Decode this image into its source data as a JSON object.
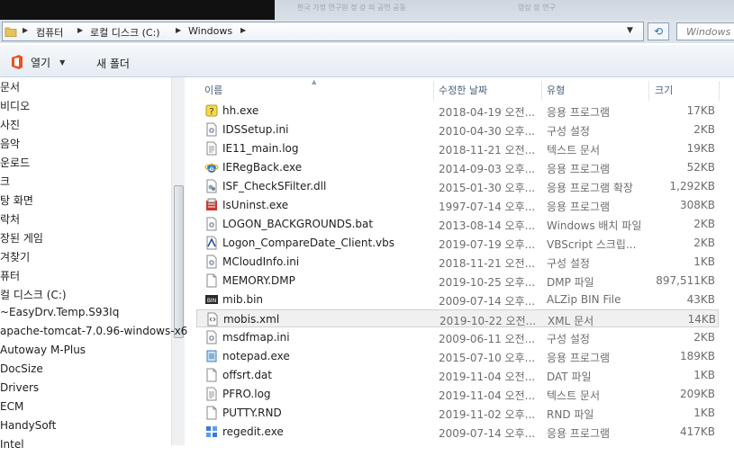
{
  "window": {
    "ghost_text_1": "한국 가정 연구원 정 강 의 공연 공동",
    "ghost_text_2": "영상 장 연구"
  },
  "address": {
    "crumbs": [
      "컴퓨터",
      "로컬 디스크 (C:)",
      "Windows"
    ],
    "search_placeholder": "Windows"
  },
  "toolbar": {
    "open_label": "열기",
    "new_folder_label": "새 폴더"
  },
  "nav": {
    "items": [
      "문서",
      "비디오",
      "사진",
      "음악",
      "운로드",
      "크",
      "탕 화면",
      "락처",
      "장된 게임",
      "겨찾기",
      "퓨터",
      "컬 디스크 (C:)",
      "~EasyDrv.Temp.S93Iq",
      "apache-tomcat-7.0.96-windows-x6",
      "Autoway M-Plus",
      "DocSize",
      "Drivers",
      "ECM",
      "HandySoft",
      "Intel"
    ]
  },
  "columns": {
    "name": "이름",
    "date": "수정한 날짜",
    "type": "유형",
    "size": "크기"
  },
  "files": [
    {
      "name": "hh.exe",
      "date": "2018-04-19 오전...",
      "type": "응용 프로그램",
      "size": "17KB",
      "icon": "help-exe-icon"
    },
    {
      "name": "IDSSetup.ini",
      "date": "2010-04-30 오후...",
      "type": "구성 설정",
      "size": "2KB",
      "icon": "ini-file-icon"
    },
    {
      "name": "IE11_main.log",
      "date": "2018-11-21 오전...",
      "type": "텍스트 문서",
      "size": "19KB",
      "icon": "text-file-icon"
    },
    {
      "name": "IERegBack.exe",
      "date": "2014-09-03 오후...",
      "type": "응용 프로그램",
      "size": "52KB",
      "icon": "ie-exe-icon"
    },
    {
      "name": "ISF_CheckSFilter.dll",
      "date": "2015-01-30 오후...",
      "type": "응용 프로그램 확장",
      "size": "1,292KB",
      "icon": "dll-file-icon"
    },
    {
      "name": "IsUninst.exe",
      "date": "1997-07-14 오후...",
      "type": "응용 프로그램",
      "size": "308KB",
      "icon": "uninstall-exe-icon"
    },
    {
      "name": "LOGON_BACKGROUNDS.bat",
      "date": "2013-08-14 오후...",
      "type": "Windows 배치 파일",
      "size": "2KB",
      "icon": "bat-file-icon"
    },
    {
      "name": "Logon_CompareDate_Client.vbs",
      "date": "2019-07-19 오후...",
      "type": "VBScript 스크립...",
      "size": "2KB",
      "icon": "vbs-file-icon"
    },
    {
      "name": "MCloudInfo.ini",
      "date": "2018-11-21 오전...",
      "type": "구성 설정",
      "size": "1KB",
      "icon": "ini-file-icon"
    },
    {
      "name": "MEMORY.DMP",
      "date": "2019-10-25 오후...",
      "type": "DMP 파일",
      "size": "897,511KB",
      "icon": "generic-file-icon"
    },
    {
      "name": "mib.bin",
      "date": "2009-07-14 오후...",
      "type": "ALZip BIN File",
      "size": "43KB",
      "icon": "bin-file-icon"
    },
    {
      "name": "mobis.xml",
      "date": "2019-10-22 오전...",
      "type": "XML 문서",
      "size": "14KB",
      "icon": "xml-file-icon",
      "selected": true
    },
    {
      "name": "msdfmap.ini",
      "date": "2009-06-11 오전...",
      "type": "구성 설정",
      "size": "2KB",
      "icon": "ini-file-icon"
    },
    {
      "name": "notepad.exe",
      "date": "2015-07-10 오후...",
      "type": "응용 프로그램",
      "size": "189KB",
      "icon": "notepad-exe-icon"
    },
    {
      "name": "offsrt.dat",
      "date": "2019-11-04 오전...",
      "type": "DAT 파일",
      "size": "1KB",
      "icon": "generic-file-icon"
    },
    {
      "name": "PFRO.log",
      "date": "2019-11-04 오전...",
      "type": "텍스트 문서",
      "size": "209KB",
      "icon": "text-file-icon"
    },
    {
      "name": "PUTTY.RND",
      "date": "2019-11-02 오후...",
      "type": "RND 파일",
      "size": "1KB",
      "icon": "generic-file-icon"
    },
    {
      "name": "regedit.exe",
      "date": "2009-07-14 오후...",
      "type": "응용 프로그램",
      "size": "417KB",
      "icon": "regedit-exe-icon"
    }
  ]
}
